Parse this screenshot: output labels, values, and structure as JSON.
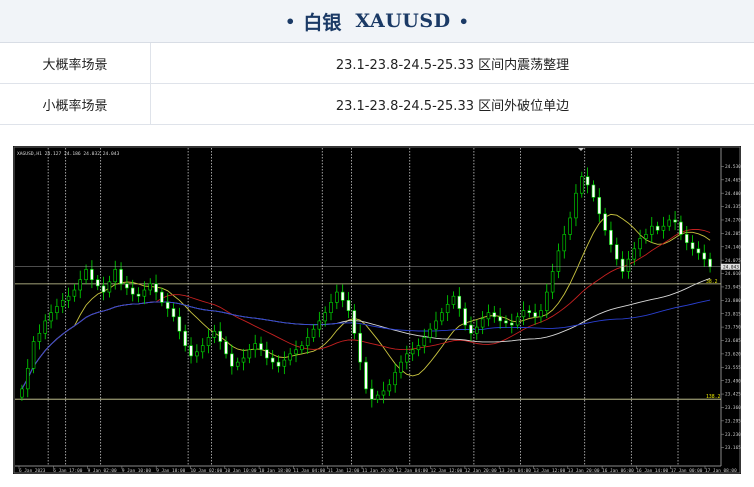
{
  "header": {
    "title_cn": "白银",
    "symbol": "XAUUSD",
    "bullet": "•"
  },
  "scenarios": [
    {
      "label": "大概率场景",
      "text": "23.1-23.8-24.5-25.33 区间内震荡整理"
    },
    {
      "label": "小概率场景",
      "text": "23.1-23.8-24.5-25.33 区间外破位单边"
    }
  ],
  "chart_data": {
    "type": "candlestick",
    "caption": "XAGUSD,H1  24.127 24.186 24.032 24.043",
    "y_range": [
      23.1,
      24.6
    ],
    "y_ticks": [
      "24.530",
      "24.465",
      "24.400",
      "24.335",
      "24.270",
      "24.205",
      "24.140",
      "24.075",
      "24.010",
      "23.945",
      "23.880",
      "23.815",
      "23.750",
      "23.685",
      "23.620",
      "23.555",
      "23.490",
      "23.425",
      "23.360",
      "23.295",
      "23.230",
      "23.165"
    ],
    "y_tick_values": [
      24.53,
      24.465,
      24.4,
      24.335,
      24.27,
      24.205,
      24.14,
      24.075,
      24.01,
      23.945,
      23.88,
      23.815,
      23.75,
      23.685,
      23.62,
      23.555,
      23.49,
      23.425,
      23.36,
      23.295,
      23.23,
      23.165
    ],
    "current_price": "24.043",
    "current_price_value": 24.043,
    "levels": [
      {
        "label": "38.2",
        "value": 23.96
      },
      {
        "label": "138.2",
        "value": 23.4
      }
    ],
    "x_labels": [
      "6 Jan 2023",
      "6 Jan 17:00",
      "9 Jan 02:00",
      "9 Jan 10:00",
      "9 Jan 18:00",
      "10 Jan 02:00",
      "10 Jan 10:00",
      "10 Jan 18:00",
      "11 Jan 04:00",
      "11 Jan 12:00",
      "11 Jan 20:00",
      "12 Jan 04:00",
      "12 Jan 12:00",
      "12 Jan 20:00",
      "13 Jan 04:00",
      "13 Jan 12:00",
      "13 Jan 20:00",
      "16 Jan 06:00",
      "16 Jan 14:00",
      "17 Jan 00:00",
      "17 Jan 08:00"
    ],
    "session_separators": [
      5,
      8,
      14,
      29,
      33,
      52,
      57,
      67,
      78,
      86,
      97,
      105,
      113
    ],
    "closes": [
      23.45,
      23.55,
      23.68,
      23.72,
      23.78,
      23.82,
      23.85,
      23.88,
      23.9,
      23.93,
      23.98,
      24.03,
      23.98,
      23.95,
      23.92,
      23.97,
      24.03,
      23.96,
      23.94,
      23.91,
      23.9,
      23.93,
      23.96,
      23.92,
      23.87,
      23.84,
      23.8,
      23.73,
      23.66,
      23.61,
      23.63,
      23.66,
      23.7,
      23.73,
      23.68,
      23.62,
      23.56,
      23.58,
      23.6,
      23.64,
      23.67,
      23.64,
      23.6,
      23.58,
      23.56,
      23.59,
      23.62,
      23.64,
      23.66,
      23.7,
      23.74,
      23.78,
      23.82,
      23.87,
      23.92,
      23.88,
      23.83,
      23.72,
      23.58,
      23.45,
      23.4,
      23.42,
      23.44,
      23.47,
      23.53,
      23.58,
      23.62,
      23.64,
      23.66,
      23.7,
      23.74,
      23.78,
      23.82,
      23.86,
      23.9,
      23.84,
      23.76,
      23.72,
      23.75,
      23.79,
      23.82,
      23.8,
      23.78,
      23.77,
      23.76,
      23.8,
      23.83,
      23.82,
      23.8,
      23.83,
      23.92,
      24.02,
      24.12,
      24.2,
      24.28,
      24.4,
      24.48,
      24.44,
      24.38,
      24.3,
      24.22,
      24.15,
      24.08,
      24.02,
      24.08,
      24.13,
      24.18,
      24.2,
      24.24,
      24.22,
      24.24,
      24.27,
      24.26,
      24.2,
      24.16,
      24.13,
      24.11,
      24.08,
      24.043
    ]
  }
}
